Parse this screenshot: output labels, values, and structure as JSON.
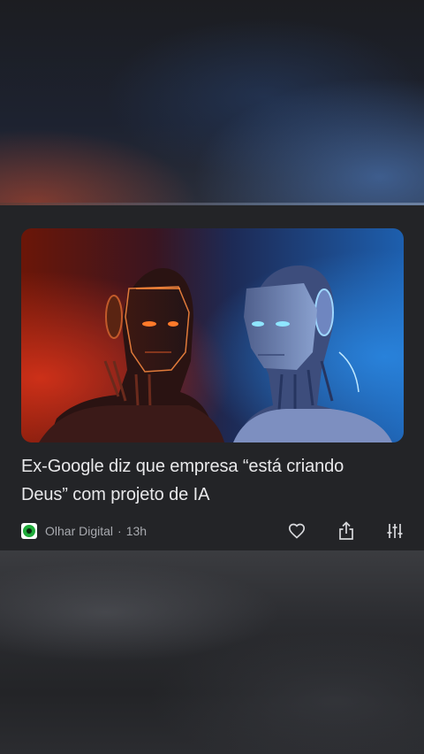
{
  "article": {
    "headline": "Ex-Google diz que empresa “está criando Deus” com projeto de IA",
    "source": "Olhar Digital",
    "separator": "·",
    "time": "13h",
    "image": "Two robot faces, one lit red, one lit blue",
    "actions": [
      {
        "name": "like",
        "icon": "heart-icon"
      },
      {
        "name": "share",
        "icon": "share-icon"
      },
      {
        "name": "more",
        "icon": "sliders-icon"
      }
    ]
  },
  "colors": {
    "card_bg": "#232427",
    "headline": "#e8e8ea",
    "meta_text": "#a8aaaf",
    "source_logo_green": "#1faa3a",
    "robot_left_glow": "#ff6a2a",
    "robot_right_glow": "#7fd4ff"
  }
}
